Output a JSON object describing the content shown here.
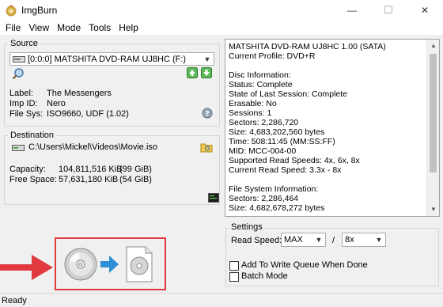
{
  "window": {
    "title": "ImgBurn",
    "minimize_glyph": "—",
    "maximize_glyph": "☐",
    "close_glyph": "✕"
  },
  "menu": [
    "File",
    "View",
    "Mode",
    "Tools",
    "Help"
  ],
  "source": {
    "group_label": "Source",
    "drive": "[0:0:0] MATSHITA DVD-RAM UJ8HC (F:)",
    "label_key": "Label:",
    "label_value": "The Messengers",
    "imp_id_key": "Imp ID:",
    "imp_id_value": "Nero",
    "file_sys_key": "File Sys:",
    "file_sys_value": "ISO9660, UDF (1.02)"
  },
  "destination": {
    "group_label": "Destination",
    "path": "C:\\Users\\Mickel\\Videos\\Movie.iso",
    "capacity_key": "Capacity:",
    "capacity_kib": "104,811,516 KiB",
    "capacity_gib": "(99 GiB)",
    "free_key": "Free Space:",
    "free_kib": "57,631,180 KiB",
    "free_gib": "(54 GiB)"
  },
  "info_lines": [
    "MATSHITA DVD-RAM UJ8HC 1.00 (SATA)",
    "Current Profile: DVD+R",
    "",
    "Disc Information:",
    "Status: Complete",
    "State of Last Session: Complete",
    "Erasable: No",
    "Sessions: 1",
    "Sectors: 2,286,720",
    "Size: 4,683,202,560 bytes",
    "Time: 508:11:45 (MM:SS:FF)",
    "MID: MCC-004-00",
    "Supported Read Speeds: 4x, 6x, 8x",
    "Current Read Speed: 3.3x - 8x",
    "",
    "File System Information:",
    "Sectors: 2,286,464",
    "Size: 4,682,678,272 bytes"
  ],
  "settings": {
    "group_label": "Settings",
    "read_speed_label": "Read Speed:",
    "read_speed_value": "MAX",
    "separator": "/",
    "multiplier_value": "8x",
    "queue_label": "Add To Write Queue When Done",
    "batch_label": "Batch Mode"
  },
  "status": "Ready",
  "colors": {
    "highlight_box": "#e0393e",
    "arrow_red": "#e0393e",
    "arrow_blue": "#2e8fd6"
  }
}
